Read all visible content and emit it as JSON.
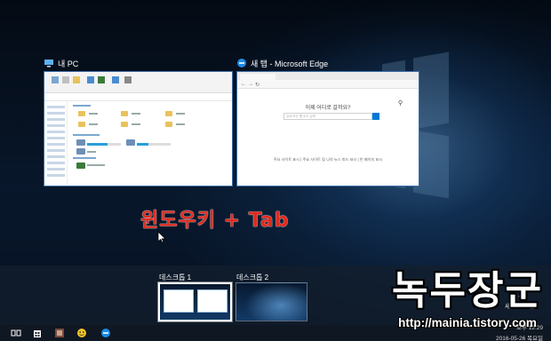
{
  "windows": [
    {
      "title": "내 PC",
      "icon": "this-pc-icon"
    },
    {
      "title": "새 탭 - Microsoft Edge",
      "icon": "edge-icon"
    }
  ],
  "edge": {
    "question": "이제 어디로 갈까요?",
    "search_placeholder": "검색 또는 웹 주소 입력",
    "footer": "주요 사이트 표시 | 주요 사이트 및 나의 뉴스 피드 표시 | 빈 페이지 표시",
    "nav": [
      "←",
      "→",
      "↻"
    ]
  },
  "annotation": "윈도우키 + Tab",
  "desktops": [
    {
      "label": "데스크톱 1"
    },
    {
      "label": "데스크톱 2"
    }
  ],
  "new_desktop": {
    "icon": "+",
    "label": "새 데스크톱"
  },
  "watermark": {
    "title": "녹두장군",
    "url": "http://mainia.tistory.com"
  },
  "tray": {
    "time": "오후 12:29",
    "date": "2016-05-26 목요일"
  },
  "colors": {
    "annotation": "#e02a1e",
    "accent": "#0078d7",
    "taskbar": "#0f1722"
  },
  "taskbar_icons": [
    "task-view-icon",
    "store-icon",
    "media-icon",
    "game-icon",
    "edge-icon"
  ]
}
